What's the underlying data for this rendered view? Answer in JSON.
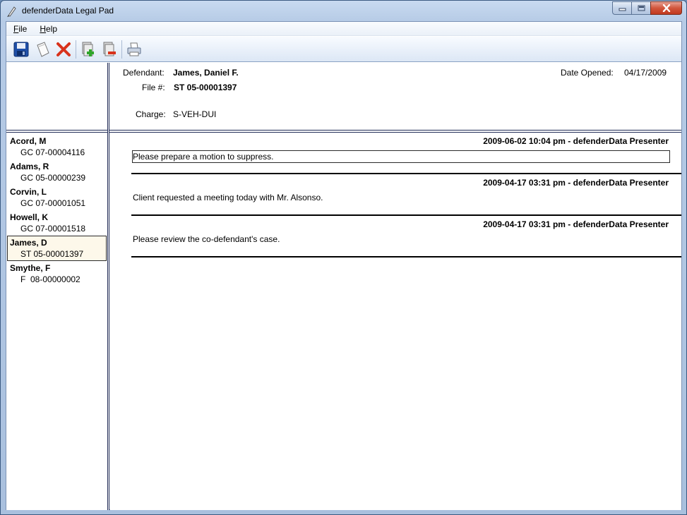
{
  "window": {
    "title": "defenderData  Legal Pad"
  },
  "menu": [
    {
      "label": "File",
      "accel": "F",
      "rest": "ile"
    },
    {
      "label": "Help",
      "accel": "H",
      "rest": "elp"
    }
  ],
  "toolbar": {
    "buttons": [
      {
        "name": "save",
        "icon": "floppy-disk-icon"
      },
      {
        "name": "new-note",
        "icon": "notepad-icon"
      },
      {
        "name": "delete",
        "icon": "red-x-icon"
      },
      {
        "name": "add-case",
        "icon": "add-document-icon"
      },
      {
        "name": "remove-case",
        "icon": "remove-document-icon"
      },
      {
        "name": "print",
        "icon": "printer-icon"
      }
    ]
  },
  "header": {
    "defendant_label": "Defendant:",
    "defendant_value": "James, Daniel F.",
    "file_label": "File #:",
    "file_value": "ST 05-00001397",
    "charge_label": "Charge:",
    "charge_value": "S-VEH-DUI",
    "date_opened_label": "Date Opened:",
    "date_opened_value": "04/17/2009"
  },
  "cases": [
    {
      "name": "Acord, M",
      "file": "GC 07-00004116",
      "selected": false
    },
    {
      "name": "Adams, R",
      "file": "GC 05-00000239",
      "selected": false
    },
    {
      "name": "Corvin, L",
      "file": "GC 07-00001051",
      "selected": false
    },
    {
      "name": "Howell, K",
      "file": "GC 07-00001518",
      "selected": false
    },
    {
      "name": "James, D",
      "file": "ST 05-00001397",
      "selected": true
    },
    {
      "name": "Smythe, F",
      "file": "F  08-00000002",
      "selected": false
    }
  ],
  "notes": [
    {
      "header": "2009-06-02 10:04 pm - defenderData Presenter",
      "text": "Please prepare a motion to suppress.",
      "editing": true
    },
    {
      "header": "2009-04-17 03:31 pm - defenderData Presenter",
      "text": "Client requested a meeting today with Mr. Alsonso.",
      "editing": false
    },
    {
      "header": "2009-04-17 03:31 pm - defenderData Presenter",
      "text": "Please review the co-defendant's case.",
      "editing": false
    }
  ],
  "colors": {
    "accent_border": "#1f2a55",
    "selected_bg": "#fdf8ea",
    "close_button": "#c13a1f"
  }
}
